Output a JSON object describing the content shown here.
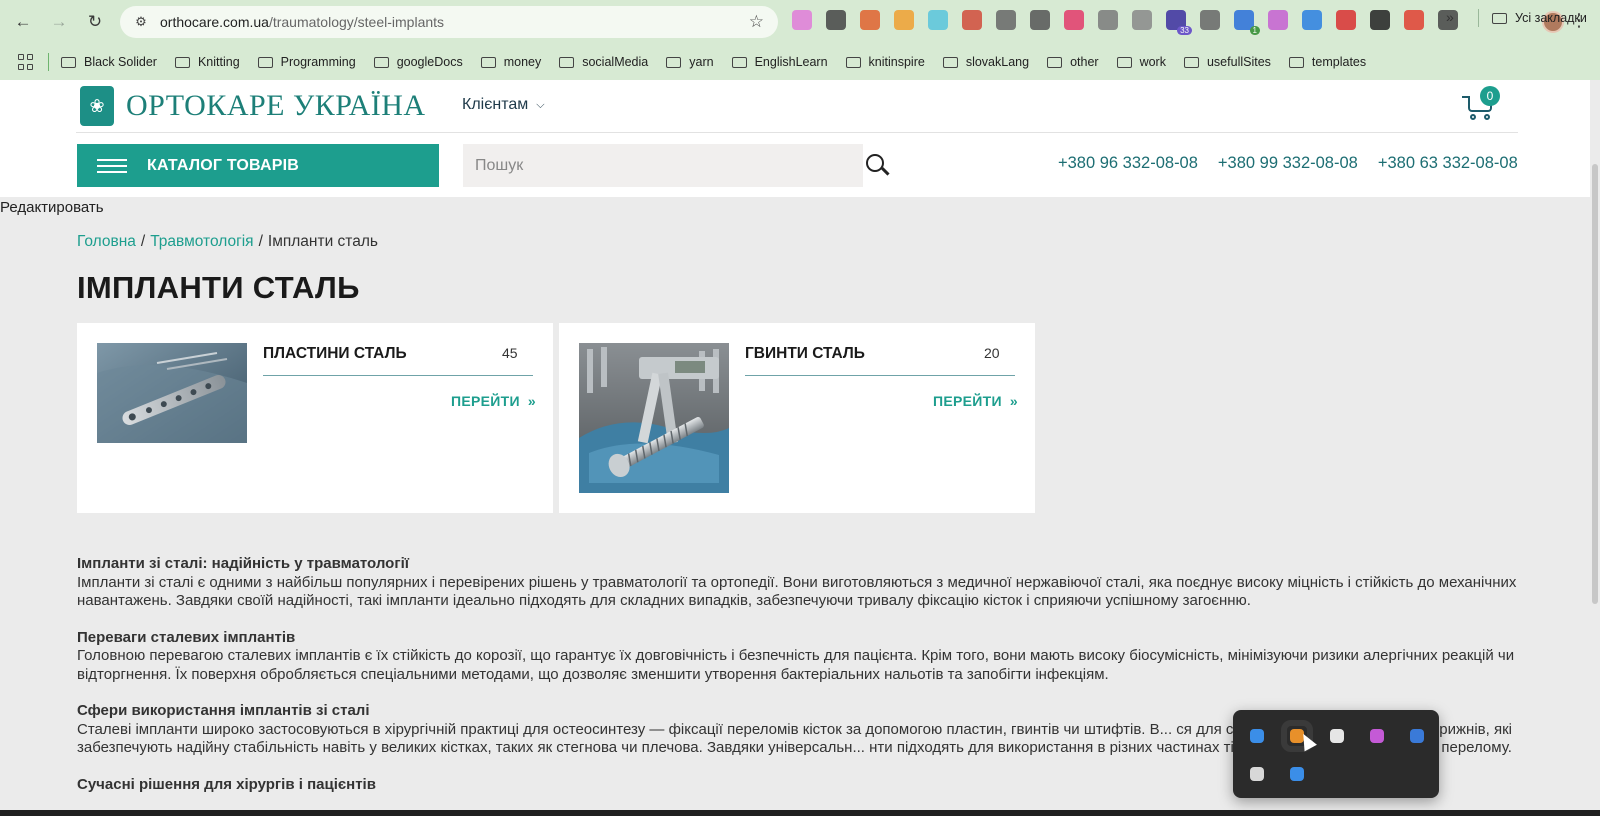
{
  "browser": {
    "url_host": "orthocare.com.ua",
    "url_path": "/traumatology/steel-implants",
    "extensions": [
      {
        "icon": "gradient-square-icon",
        "color": "#e07bd8"
      },
      {
        "icon": "screen-capture-icon",
        "color": "#444444"
      },
      {
        "icon": "color-wheel-icon",
        "color": "#e0622d"
      },
      {
        "icon": "orange-tool-icon",
        "color": "#f0a030"
      },
      {
        "icon": "react-devtools-icon",
        "color": "#58c4dc"
      },
      {
        "icon": "org-chart-icon",
        "color": "#d14b3a"
      },
      {
        "icon": "camera-icon",
        "color": "#666666"
      },
      {
        "icon": "check-circle-icon",
        "color": "#555555"
      },
      {
        "icon": "number-two-icon",
        "color": "#e33a6a"
      },
      {
        "icon": "dots-icon",
        "color": "#7a7a7a"
      },
      {
        "icon": "compass-icon",
        "color": "#888888"
      },
      {
        "icon": "graduation-cap-icon",
        "color": "#3b2fa0",
        "badge": "33"
      },
      {
        "icon": "translate-icon",
        "color": "#666666"
      },
      {
        "icon": "code-icon",
        "color": "#2a6fdb",
        "badge": "1"
      },
      {
        "icon": "rainbow-ring-icon",
        "color": "#c55fd1"
      },
      {
        "icon": "tag-icon",
        "color": "#2a7fe0"
      },
      {
        "icon": "flag-icon",
        "color": "#d93030"
      },
      {
        "icon": "panda-icon",
        "color": "#222222"
      },
      {
        "icon": "split-window-icon",
        "color": "#e04030"
      },
      {
        "icon": "puzzle-icon",
        "color": "#444444"
      }
    ],
    "bookmarks": [
      "Black Solider",
      "Knitting",
      "Programming",
      "googleDocs",
      "money",
      "socialMedia",
      "yarn",
      "EnglishLearn",
      "knitinspire",
      "slovakLang",
      "other",
      "work",
      "usefullSites",
      "templates"
    ],
    "all_bookmarks_label": "Усі закладки"
  },
  "site": {
    "logo_text": "ОРТОКАРЕ УКРАЇНА",
    "clients_label": "Клієнтам",
    "cart_count": "0",
    "catalog_label": "КАТАЛОГ ТОВАРІВ",
    "search_placeholder": "Пошук",
    "phones": [
      "+380 96 332-08-08",
      "+380 99 332-08-08",
      "+380 63 332-08-08"
    ],
    "edit_label": "Редактировать",
    "accent_color": "#1d9e8e"
  },
  "breadcrumb": {
    "home": "Головна",
    "section": "Травмотологія",
    "current": "Імпланти сталь",
    "separator": "/"
  },
  "page_title": "ІМПЛАНТИ СТАЛЬ",
  "categories": [
    {
      "name": "ПЛАСТИНИ СТАЛЬ",
      "count": "45",
      "go_label": "ПЕРЕЙТИ"
    },
    {
      "name": "ГВИНТИ СТАЛЬ",
      "count": "20",
      "go_label": "ПЕРЕЙТИ"
    }
  ],
  "article": [
    {
      "heading": "Імпланти зі сталі: надійність у травматології",
      "text": "Імпланти зі сталі є одними з найбільш популярних і перевірених рішень у травматології та ортопедії. Вони виготовляються з медичної нержавіючої сталі, яка поєднує високу міцність і стійкість до механічних навантажень. Завдяки своїй надійності, такі імпланти ідеально підходять для складних випадків, забезпечуючи тривалу фіксацію кісток і сприяючи успішному загоєнню."
    },
    {
      "heading": "Переваги сталевих імплантів",
      "text": "Головною перевагою сталевих імплантів є їх стійкість до корозії, що гарантує їх довговічність і безпечність для пацієнта. Крім того, вони мають високу біосумісність, мінімізуючи ризики алергічних реакцій чи відторгнення. Їх поверхня обробляється спеціальними методами, що дозволяє зменшити утворення бактеріальних нальотів та запобігти інфекціям."
    },
    {
      "heading": "Сфери використання імплантів зі сталі",
      "text": "Сталеві імпланти широко застосовуються в хірургічній практиці для остеосинтезу — фіксації переломів кісток за допомогою пластин, гвинтів чи штифтів. В... ся для створення інтрамедулярних стрижнів, які забезпечують надійну стабільність навіть у великих кістках, таких як стегнова чи плечова. Завдяки універсальн... нти підходять для використання в різних частинах тіла, незалежно від складності перелому."
    },
    {
      "heading": "Сучасні рішення для хірургів і пацієнтів",
      "text": ""
    }
  ],
  "tray": {
    "icons": [
      {
        "icon": "vpn-icon",
        "color": "#3b8ee8"
      },
      {
        "icon": "office-icon",
        "color": "#e8902a"
      },
      {
        "icon": "telegram-icon",
        "color": "#e6e6e6"
      },
      {
        "icon": "mirror-app-icon",
        "color": "#c45ad6"
      },
      {
        "icon": "security-warning-icon",
        "color": "#3a7ad8"
      },
      {
        "icon": "media-cast-icon",
        "color": "#d8d8d8"
      },
      {
        "icon": "bluetooth-icon",
        "color": "#3b8ee8"
      }
    ]
  }
}
